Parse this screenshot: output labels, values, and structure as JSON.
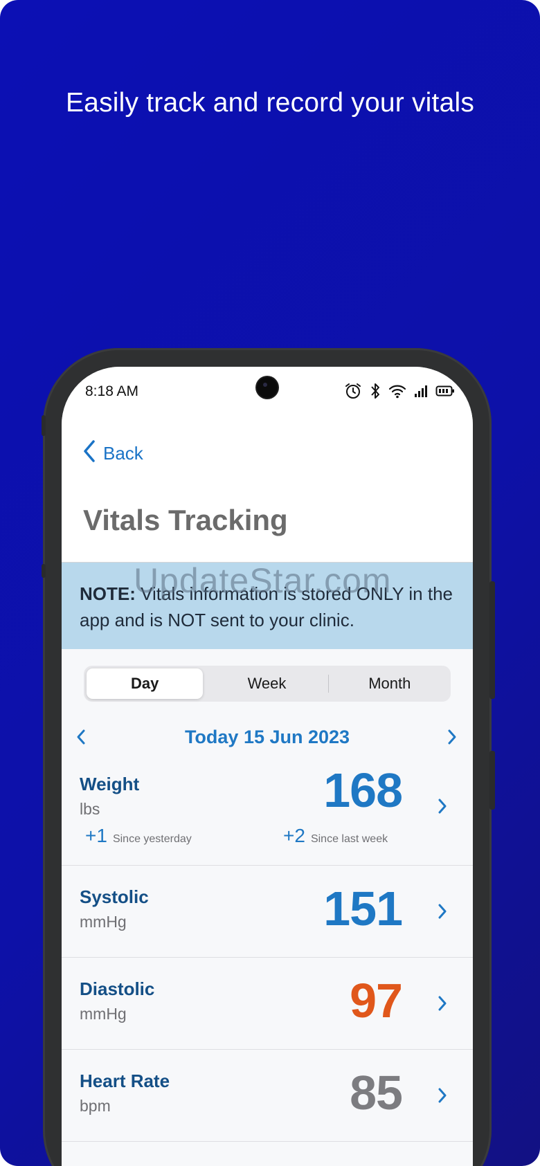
{
  "headline": "Easily track and record your vitals",
  "status_bar": {
    "time": "8:18 AM"
  },
  "nav": {
    "back_label": "Back"
  },
  "page_title": "Vitals Tracking",
  "note": {
    "prefix": "NOTE:",
    "text": " Vitals information is stored ONLY in the app and is NOT sent to your clinic."
  },
  "watermark": "UpdateStar.com",
  "tabs": [
    {
      "label": "Day",
      "active": true
    },
    {
      "label": "Week",
      "active": false
    },
    {
      "label": "Month",
      "active": false
    }
  ],
  "date_label": "Today 15 Jun 2023",
  "vitals": [
    {
      "name": "Weight",
      "unit": "lbs",
      "value": "168",
      "color": "#1f78c4",
      "deltas": [
        {
          "value": "+1",
          "label": "Since yesterday"
        },
        {
          "value": "+2",
          "label": "Since last week"
        }
      ]
    },
    {
      "name": "Systolic",
      "unit": "mmHg",
      "value": "151",
      "color": "#1f78c4"
    },
    {
      "name": "Diastolic",
      "unit": "mmHg",
      "value": "97",
      "color": "#e0571b"
    },
    {
      "name": "Heart Rate",
      "unit": "bpm",
      "value": "85",
      "color": "#7c7c80"
    }
  ],
  "colors": {
    "background": "#0d11a8",
    "accent": "#1f78c4",
    "note_bg": "#b8d8ec",
    "heading": "#144f86"
  }
}
